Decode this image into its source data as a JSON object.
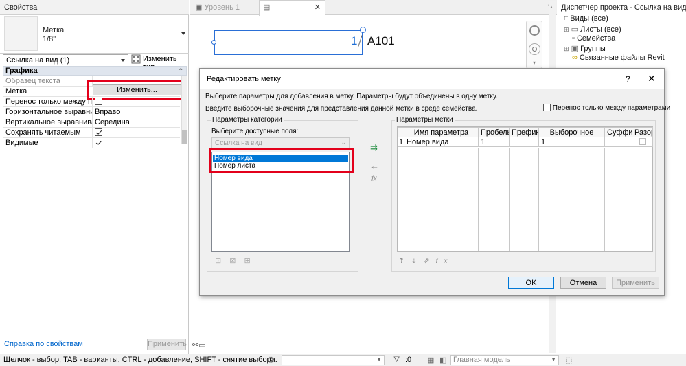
{
  "properties": {
    "title": "Свойства",
    "type_name": "Метка",
    "type_size": "1/8\"",
    "instance_selector": "Ссылка на вид (1)",
    "edit_type_label": "Изменить тип",
    "section": "Графика",
    "rows": [
      {
        "label": "Образец текста",
        "value": ""
      },
      {
        "label": "Метка",
        "value": "Изменить..."
      },
      {
        "label": "Перенос только между па...",
        "value": ""
      },
      {
        "label": "Горизонтальное выравнив...",
        "value": "Вправо"
      },
      {
        "label": "Вертикальное выравниван...",
        "value": "Середина"
      },
      {
        "label": "Сохранять читаемым",
        "value": ""
      },
      {
        "label": "Видимые",
        "value": ""
      }
    ],
    "help_link": "Справка по свойствам",
    "apply_label": "Применить"
  },
  "canvas": {
    "tab_level": "Уровень 1",
    "tag_number": "1",
    "tag_sheet": "A101"
  },
  "browser": {
    "title": "Диспетчер проекта - Ссылка на вид.rfa",
    "items": [
      "Виды (все)",
      "Листы (все)",
      "Семейства",
      "Группы",
      "Связанные файлы Revit"
    ]
  },
  "dialog": {
    "title": "Редактировать метку",
    "help": "?",
    "close": "✕",
    "instruction1": "Выберите параметры для добавления в метку.  Параметры будут объединены в одну метку.",
    "instruction2": "Введите выборочные значения для представления данной метки в среде семейства.",
    "wrap_label": "Перенос только между параметрами",
    "category_group": "Параметры категории",
    "fields_label": "Выберите доступные поля:",
    "fields_combo": "Ссылка на вид",
    "fields": [
      "Номер вида",
      "Номер листа"
    ],
    "label_group": "Параметры метки",
    "columns": [
      "Имя параметра",
      "Пробелы",
      "Префикс",
      "Выборочное",
      "Суффикс",
      "Разор"
    ],
    "rows": [
      {
        "n": "1",
        "name": "Номер вида",
        "spaces": "1",
        "prefix": "",
        "sample": "1",
        "suffix": ""
      }
    ],
    "ok": "OK",
    "cancel": "Отмена",
    "apply": "Применить"
  },
  "status": {
    "hint": "Щелчок - выбор, TAB - варианты, CTRL - добавление, SHIFT - снятие выбора.",
    "count": ":0",
    "model": "Главная модель"
  },
  "colors": {
    "highlight": "#e3001b",
    "selection": "#0078d7"
  }
}
